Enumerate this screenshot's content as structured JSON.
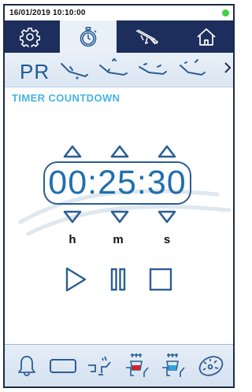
{
  "status": {
    "datetime": "16/01/2019 10:10:00",
    "indicator_color": "#3fcf45"
  },
  "tabs": [
    {
      "name": "settings",
      "icon": "gear-icon"
    },
    {
      "name": "timer",
      "icon": "stopwatch-icon",
      "active": true
    },
    {
      "name": "instruments",
      "icon": "handpiece-icon"
    },
    {
      "name": "home",
      "icon": "home-icon"
    }
  ],
  "programs": {
    "label": "PR",
    "items": [
      {
        "icon": "chair-position-1-icon"
      },
      {
        "icon": "chair-position-2-icon"
      },
      {
        "icon": "chair-position-3-icon"
      },
      {
        "icon": "chair-position-4-icon"
      }
    ],
    "more_icon": "chevron-right-icon"
  },
  "screen": {
    "title": "TIMER COUNTDOWN"
  },
  "timer": {
    "display": "00:25:30",
    "units": {
      "hours": "h",
      "minutes": "m",
      "seconds": "s"
    }
  },
  "controls": [
    {
      "icon": "play-icon"
    },
    {
      "icon": "pause-icon"
    },
    {
      "icon": "stop-icon"
    }
  ],
  "bottom_bar": [
    {
      "icon": "bell-icon"
    },
    {
      "icon": "blank-button-icon"
    },
    {
      "icon": "spittoon-icon"
    },
    {
      "icon": "cup-filler-hot-icon"
    },
    {
      "icon": "cup-filler-cold-icon"
    },
    {
      "icon": "operating-light-icon"
    }
  ],
  "colors": {
    "navy": "#1d2e5c",
    "accent_blue": "#2b5d95",
    "title_cyan": "#49b3e2",
    "timer_text": "#1f6fae"
  }
}
